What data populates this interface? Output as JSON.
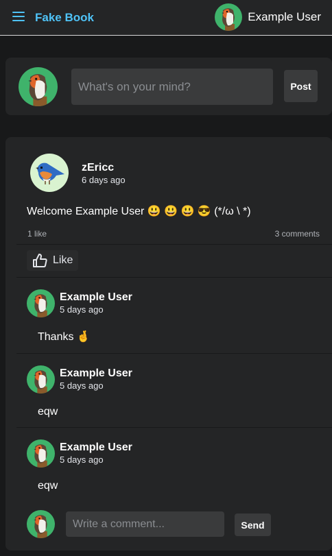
{
  "app": {
    "title": "Fake Book"
  },
  "header": {
    "user_name": "Example User"
  },
  "composer": {
    "placeholder": "What's on your mind?",
    "post_label": "Post"
  },
  "post": {
    "author": "zEricc",
    "time": "6 days ago",
    "body": "Welcome Example User 😃 😃 😃 😎 (*/ω \\ *)",
    "likes": "1 like",
    "comments_count": "3 comments",
    "like_label": "Like"
  },
  "comments": [
    {
      "author": "Example User",
      "time": "5 days ago",
      "text": "Thanks 🤞"
    },
    {
      "author": "Example User",
      "time": "5 days ago",
      "text": "eqw"
    },
    {
      "author": "Example User",
      "time": "5 days ago",
      "text": "eqw"
    }
  ],
  "reply": {
    "placeholder": "Write a comment...",
    "send_label": "Send"
  },
  "colors": {
    "accent": "#4fc3f7",
    "background": "#18191a",
    "card": "#242526",
    "avatar_green": "#3fb36b",
    "bluebird_bg": "#d9f3d0"
  },
  "icons": {
    "menu": "hamburger-icon",
    "like": "thumbs-up-icon",
    "user_avatar": "robin-bird-avatar",
    "author_avatar": "bluebird-avatar"
  }
}
